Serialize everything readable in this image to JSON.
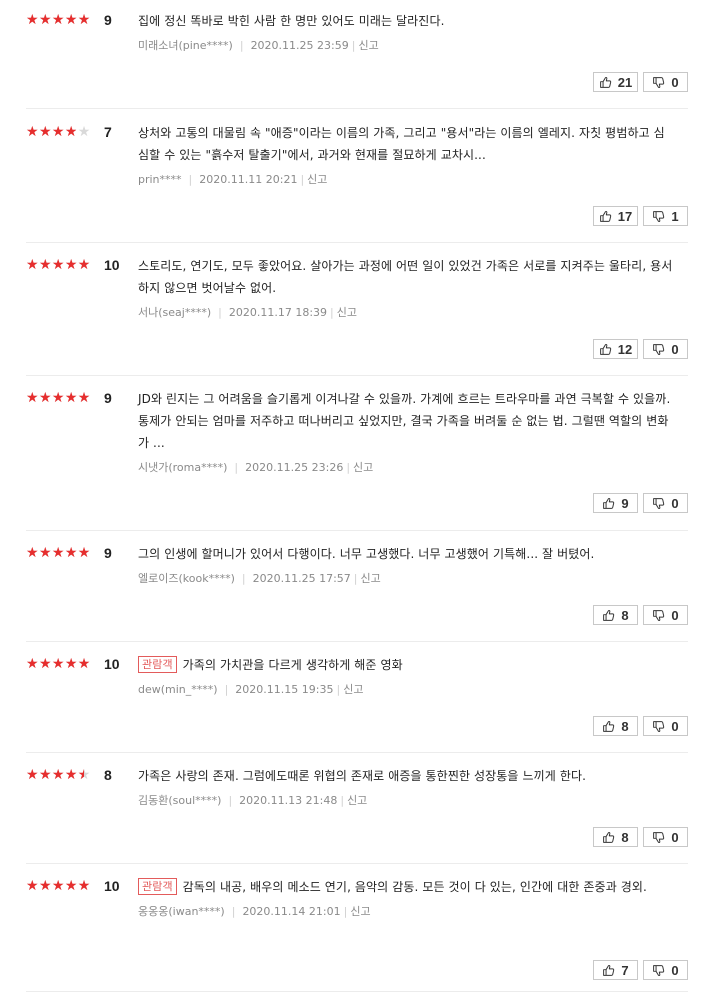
{
  "reviews": [
    {
      "rating": 4.5,
      "score": "9",
      "badge": "",
      "text": "집에 정신 똑바로 박힌 사람 한 명만 있어도 미래는 달라진다.",
      "author": "미래소녀(pine****)",
      "date": "2020.11.25 23:59",
      "report": "신고",
      "likes": "21",
      "dislikes": "0"
    },
    {
      "rating": 3.5,
      "score": "7",
      "badge": "",
      "text": "상처와 고통의 대물림 속 \"애증\"이라는 이름의 가족, 그리고 \"용서\"라는 이름의 엘레지. 자칫 평범하고 심심할 수 있는 \"흙수저 탈출기\"에서, 과거와 현재를 절묘하게 교차시...",
      "author": "prin****",
      "date": "2020.11.11 20:21",
      "report": "신고",
      "likes": "17",
      "dislikes": "1"
    },
    {
      "rating": 5,
      "score": "10",
      "badge": "",
      "text": "스토리도, 연기도, 모두 좋았어요. 살아가는 과정에 어떤 일이 있었건 가족은 서로를 지켜주는 울타리, 용서하지 않으면 벗어날수 없어.",
      "author": "서나(seaj****)",
      "date": "2020.11.17 18:39",
      "report": "신고",
      "likes": "12",
      "dislikes": "0"
    },
    {
      "rating": 4.5,
      "score": "9",
      "badge": "",
      "text": "JD와 린지는 그 어려움을 슬기롭게 이겨나갈 수 있을까. 가계에 흐르는 트라우마를 과연 극복할 수 있을까. 통제가 안되는 엄마를 저주하고 떠나버리고 싶었지만, 결국 가족을 버려둘 순 없는 법. 그럴땐 역할의 변화가 ...",
      "author": "시냇가(roma****)",
      "date": "2020.11.25 23:26",
      "report": "신고",
      "likes": "9",
      "dislikes": "0"
    },
    {
      "rating": 4.5,
      "score": "9",
      "badge": "",
      "text": "그의 인생에 할머니가 있어서 다행이다. 너무 고생했다. 너무 고생했어 기특해... 잘 버텼어.",
      "author": "엘로이즈(kook****)",
      "date": "2020.11.25 17:57",
      "report": "신고",
      "likes": "8",
      "dislikes": "0"
    },
    {
      "rating": 5,
      "score": "10",
      "badge": "관람객",
      "text": "가족의 가치관을 다르게 생각하게 해준 영화",
      "author": "dew(min_****)",
      "date": "2020.11.15 19:35",
      "report": "신고",
      "likes": "8",
      "dislikes": "0"
    },
    {
      "rating": 4,
      "score": "8",
      "badge": "",
      "text": "가족은 사랑의 존재. 그럼에도때론 위협의 존재로 애증을 통한찐한 성장통을 느끼게 한다.",
      "author": "김동환(soul****)",
      "date": "2020.11.13 21:48",
      "report": "신고",
      "likes": "8",
      "dislikes": "0"
    },
    {
      "rating": 5,
      "score": "10",
      "badge": "관람객",
      "text": "감독의 내공, 배우의 메소드 연기, 음악의 감동. 모든 것이 다 있는, 인간에 대한 존중과 경외.",
      "author": "옹옹옹(iwan****)",
      "date": "2020.11.14 21:01",
      "report": "신고",
      "likes": "7",
      "dislikes": "0"
    }
  ],
  "colors": {
    "star_fill": "#e62e2e",
    "star_empty": "#d9d9d9",
    "badge": "#e35b5b"
  },
  "icons": {
    "like": "thumbs-up-icon",
    "dislike": "thumbs-down-icon"
  }
}
